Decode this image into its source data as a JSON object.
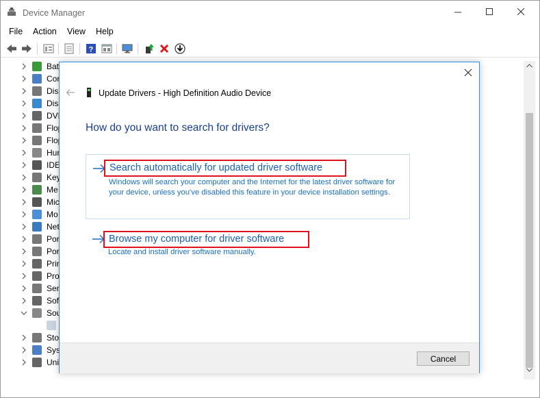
{
  "window": {
    "title": "Device Manager",
    "icons": {
      "app": "device-manager-icon"
    }
  },
  "menu": [
    "File",
    "Action",
    "View",
    "Help"
  ],
  "toolbar": {
    "buttons": [
      "back-arrow-icon",
      "forward-arrow-icon",
      "tree-view-icon",
      "properties-icon",
      "help-icon",
      "details-icon",
      "monitor-scan-icon",
      "update-driver-icon",
      "uninstall-x-icon",
      "download-icon"
    ]
  },
  "tree": {
    "nodes": [
      {
        "label": "Bat",
        "icon": "battery-icon",
        "expanded": false
      },
      {
        "label": "Cor",
        "icon": "computer-icon",
        "expanded": false
      },
      {
        "label": "Disk",
        "icon": "disk-drive-icon",
        "expanded": false
      },
      {
        "label": "Disp",
        "icon": "display-adapter-icon",
        "expanded": false
      },
      {
        "label": "DVD",
        "icon": "dvd-drive-icon",
        "expanded": false
      },
      {
        "label": "Flop",
        "icon": "floppy-controller-icon",
        "expanded": false
      },
      {
        "label": "Flop",
        "icon": "floppy-drive-icon",
        "expanded": false
      },
      {
        "label": "Hun",
        "icon": "hid-icon",
        "expanded": false
      },
      {
        "label": "IDE",
        "icon": "ide-controller-icon",
        "expanded": false
      },
      {
        "label": "Key",
        "icon": "keyboard-icon",
        "expanded": false
      },
      {
        "label": "Me",
        "icon": "memory-icon",
        "expanded": false
      },
      {
        "label": "Mic",
        "icon": "mouse-icon",
        "expanded": false
      },
      {
        "label": "Mo",
        "icon": "monitor-icon",
        "expanded": false
      },
      {
        "label": "Net",
        "icon": "network-adapter-icon",
        "expanded": false
      },
      {
        "label": "Por",
        "icon": "portable-device-icon",
        "expanded": false
      },
      {
        "label": "Por",
        "icon": "ports-icon",
        "expanded": false
      },
      {
        "label": "Prir",
        "icon": "print-queue-icon",
        "expanded": false
      },
      {
        "label": "Pro",
        "icon": "processor-icon",
        "expanded": false
      },
      {
        "label": "Sen",
        "icon": "sensor-icon",
        "expanded": false
      },
      {
        "label": "Soft",
        "icon": "software-device-icon",
        "expanded": false
      },
      {
        "label": "Sou",
        "icon": "sound-icon",
        "expanded": true
      },
      {
        "label": "",
        "icon": "speaker-icon",
        "expanded": null,
        "selected": true
      },
      {
        "label": "Sto",
        "icon": "storage-controller-icon",
        "expanded": false
      },
      {
        "label": "Syst",
        "icon": "system-device-icon",
        "expanded": false
      },
      {
        "label": "Uni",
        "icon": "usb-controller-icon",
        "expanded": false
      }
    ]
  },
  "dialog": {
    "title": "Update Drivers - High Definition Audio Device",
    "question": "How do you want to search for drivers?",
    "option_auto": {
      "title": "Search automatically for updated driver software",
      "description": "Windows will search your computer and the Internet for the latest driver software for your device, unless you've disabled this feature in your device installation settings."
    },
    "option_browse": {
      "title": "Browse my computer for driver software",
      "description": "Locate and install driver software manually."
    },
    "cancel_label": "Cancel"
  },
  "colors": {
    "link": "#1a5fb4",
    "heading": "#1a3f8f",
    "highlight": "#e0101d",
    "dialog_border": "#2e8ee6"
  }
}
